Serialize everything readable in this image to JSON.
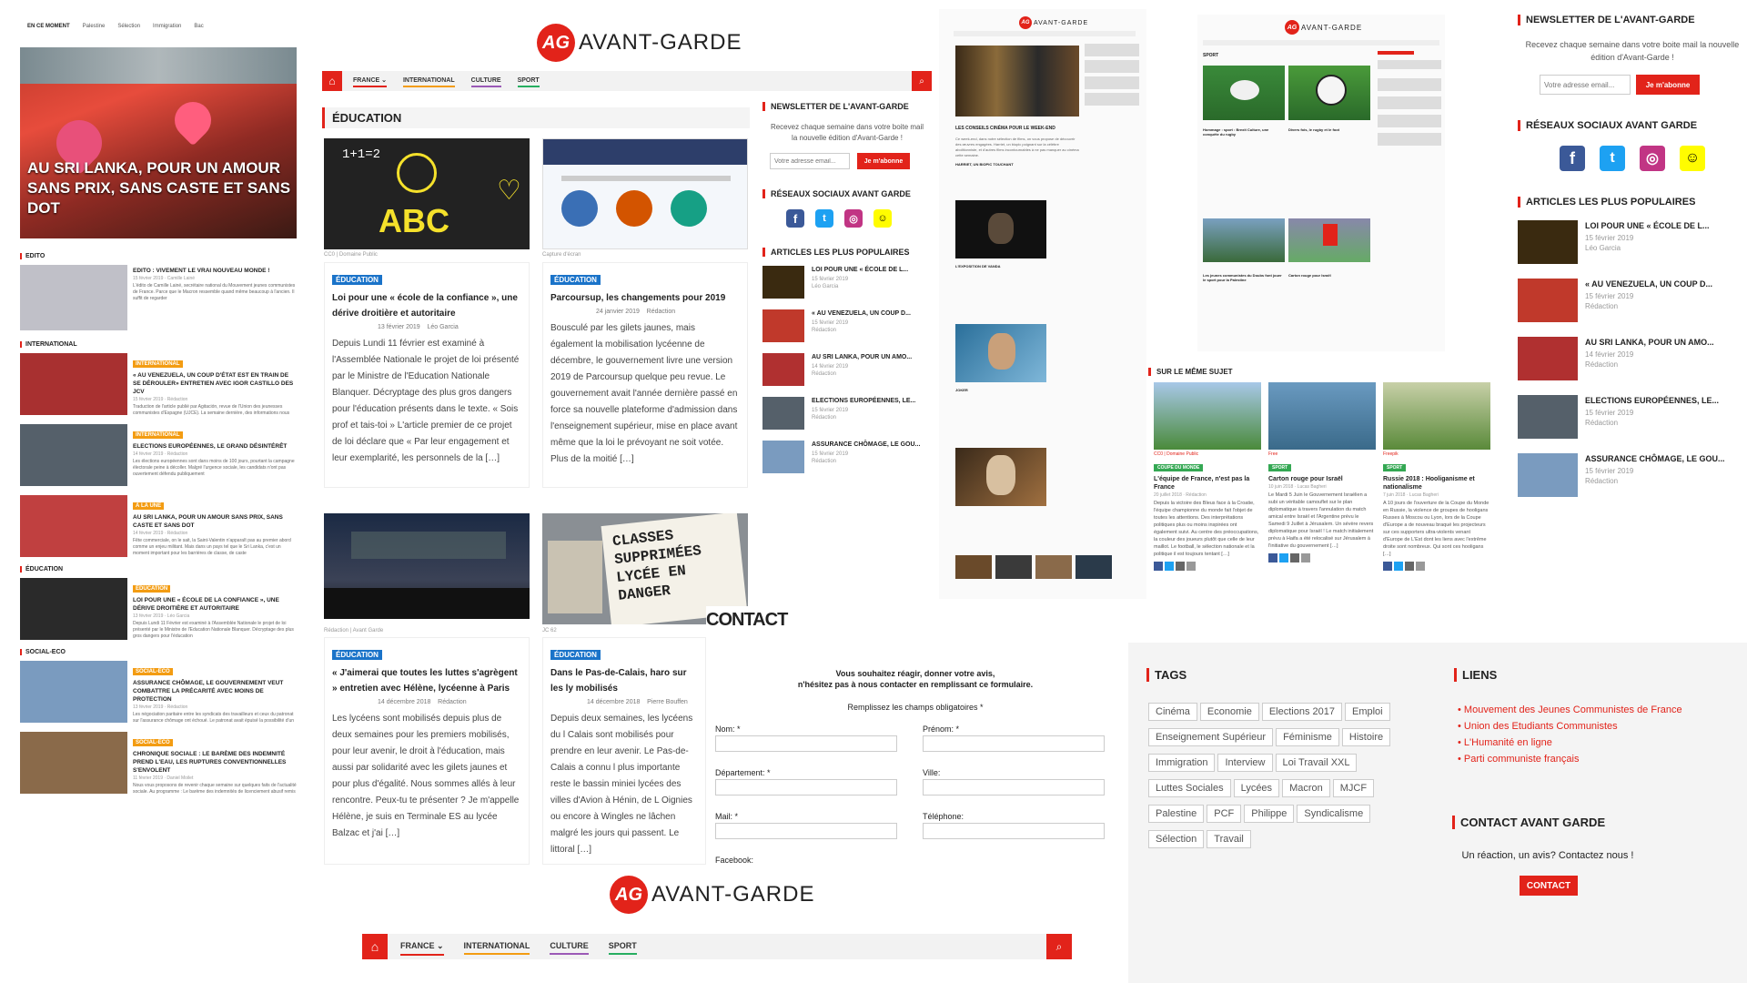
{
  "logo": {
    "initials": "AG",
    "name": "AVANT-GARDE"
  },
  "nav": {
    "items": [
      "FRANCE",
      "INTERNATIONAL",
      "CULTURE",
      "SPORT"
    ],
    "colors": [
      "#e2231a",
      "#f39c12",
      "#9b59b6",
      "#27ae60"
    ]
  },
  "mobile": {
    "breadcrumb": [
      "EN CE MOMENT",
      "Palestine",
      "Sélection",
      "Immigration",
      "Bac"
    ],
    "hero_title": "AU SRI LANKA, POUR UN AMOUR SANS PRIX, SANS CASTE ET SANS DOT",
    "sections": [
      {
        "head": "EDITO",
        "items": [
          {
            "cat": "",
            "title": "EDITO : VIVEMENT LE VRAI NOUVEAU MONDE !",
            "meta": "15 février 2019 · Camille Lainé",
            "excerpt": "L'édito de Camille Lainé, secrétaire national du Mouvement jeunes communistes de France. Parce que le Macron ressemble quand même beaucoup à l'ancien. Il suffit de regarder"
          }
        ]
      },
      {
        "head": "INTERNATIONAL",
        "items": [
          {
            "cat": "INTERNATIONAL",
            "title": "« AU VENEZUELA, UN COUP D'ÉTAT EST EN TRAIN DE SE DÉROULER» ENTRETIEN AVEC IGOR CASTILLO DES JCV",
            "meta": "15 février 2019 · Rédaction",
            "excerpt": "Traduction de l'article publié par Agitación, revue de l'Union des jeunesses communistes d'Espagne (UJCE). La semaine dernière, des informations nous sont arrivées à propos de travaux"
          },
          {
            "cat": "INTERNATIONAL",
            "title": "ELECTIONS EUROPÉENNES, LE GRAND DÉSINTÉRÊT",
            "meta": "14 février 2019 · Rédaction",
            "excerpt": "Les élections européennes sont dans moins de 100 jours, pourtant la campagne électorale peine à décoller. Malgré l'urgence sociale, les candidats n'ont pas ouvertement défendu publiquement"
          },
          {
            "cat": "À LA UNE",
            "title": "AU SRI LANKA, POUR UN AMOUR SANS PRIX, SANS CASTE ET SANS DOT",
            "meta": "14 février 2019 · Rédaction",
            "excerpt": "Fête commerciale, on le sait, la Saint-Valentin n'apparaît pas au premier abord comme un enjeu militant. Mais dans un pays tel que le Sri Lanka, c'est un moment important pour les barrières de classe, de caste"
          }
        ]
      },
      {
        "head": "ÉDUCATION",
        "items": [
          {
            "cat": "ÉDUCATION",
            "title": "LOI POUR UNE « ÉCOLE DE LA CONFIANCE », UNE DÉRIVE DROITIÈRE ET AUTORITAIRE",
            "meta": "13 février 2019 · Léo Garcia",
            "excerpt": "Depuis Lundi 11 Février est examiné à l'Assemblée Nationale le projet de loi présenté par le Ministre de l'Education Nationale Blanquer. Décryptage des plus gros dangers pour l'éducation"
          }
        ]
      },
      {
        "head": "SOCIAL-ECO",
        "items": [
          {
            "cat": "SOCIAL-ECO",
            "title": "ASSURANCE CHÔMAGE, LE GOUVERNEMENT VEUT COMBATTRE LA PRÉCARITÉ AVEC MOINS DE PROTECTION",
            "meta": "13 février 2019 · Rédaction",
            "excerpt": "Les négociation paritaire entre les syndicats des travailleurs et ceux du patronat sur l'assurance chômage ont échoué. Le patronat avait épuisé la possibilité d'un protestation de"
          },
          {
            "cat": "SOCIAL-ECO",
            "title": "CHRONIQUE SOCIALE : LE BARÈME DES INDEMNITÉ PREND L'EAU, LES RUPTURES CONVENTIONNELLES S'ENVOLENT",
            "meta": "11 février 2019 · Daniel Moilet",
            "excerpt": "Nous vous proposons de revenir chaque semaine sur quelques faits de l'actualité sociale. Au programme : Le barème des indemnités de licenciement abusif remis en question, évolutions des ruptures"
          }
        ]
      }
    ]
  },
  "education": {
    "title": "ÉDUCATION",
    "cards": [
      {
        "credit": "CC0 | Domaine Public",
        "cat": "ÉDUCATION",
        "title": "Loi pour une « école de la confiance », une dérive droitière et autoritaire",
        "date": "13 février 2019",
        "author": "Léo Garcia",
        "excerpt": "Depuis Lundi 11 février est examiné à l'Assemblée Nationale le projet de loi présenté par le Ministre de l'Education Nationale Blanquer. Décryptage des plus gros dangers pour l'éducation présents dans le texte. « Sois prof et tais-toi » L'article premier de ce projet de loi déclare que « Par leur engagement et leur exemplarité, les personnels de la […]"
      },
      {
        "credit": "Capture d'écran",
        "cat": "ÉDUCATION",
        "title": "Parcoursup, les changements pour 2019",
        "date": "24 janvier 2019",
        "author": "Rédaction",
        "excerpt": "Bousculé par les gilets jaunes, mais également la mobilisation lycéenne de décembre, le gouvernement livre une version 2019 de Parcoursup quelque peu revue. Le gouvernement avait l'année dernière passé en force sa nouvelle plateforme d'admission dans l'enseignement supérieur, mise en place avant même que la loi le prévoyant ne soit votée. Plus de la moitié […]"
      },
      {
        "credit": "Rédaction | Avant Garde",
        "cat": "ÉDUCATION",
        "title": "« J'aimerai que toutes les luttes s'agrègent » entretien avec Hélène, lycéenne à Paris",
        "date": "14 décembre 2018",
        "author": "Rédaction",
        "excerpt": "Les lycéens sont mobilisés depuis plus de deux semaines pour les premiers mobilisés, pour leur avenir, le droit à l'éducation, mais aussi par solidarité avec les gilets jaunes et pour plus d'égalité. Nous sommes allés à leur rencontre. Peux-tu te présenter ? Je m'appelle Hélène, je suis en Terminale ES au lycée Balzac et j'ai […]"
      },
      {
        "credit": "JC 62",
        "cat": "ÉDUCATION",
        "title": "Dans le Pas-de-Calais, haro sur les ly mobilisés",
        "date": "14 décembre 2018",
        "author": "Pierre Bouffen",
        "excerpt": "Depuis deux semaines, les lycéens du l Calais sont mobilisés pour prendre en leur avenir. Le Pas-de-Calais a connu l plus importante reste le bassin miniei lycées des villes d'Avion à Hénin, de L Oignies ou encore à Wingles ne lâchen malgré les jours qui passent. Le littoral […]"
      }
    ],
    "sign_text": "CLASSES SUPPRIMÉES LYCÉE EN DANGER",
    "chalk_text": "ABC"
  },
  "sidebar": {
    "newsletter_title": "NEWSLETTER DE L'AVANT-GARDE",
    "newsletter_text": "Recevez chaque semaine dans votre boite mail la nouvelle édition d'Avant-Garde !",
    "email_placeholder": "Votre adresse email...",
    "subscribe": "Je m'abonne",
    "social_title": "RÉSEAUX SOCIAUX AVANT GARDE",
    "popular_title": "ARTICLES LES PLUS POPULAIRES",
    "popular": [
      {
        "title": "LOI POUR UNE « ÉCOLE DE L...",
        "date": "15 février 2019",
        "author": "Léo Garcia"
      },
      {
        "title": "« AU VENEZUELA, UN COUP D...",
        "date": "15 février 2019",
        "author": "Rédaction"
      },
      {
        "title": "AU SRI LANKA, POUR UN AMO...",
        "date": "14 février 2019",
        "author": "Rédaction"
      },
      {
        "title": "ELECTIONS EUROPÉENNES, LE...",
        "date": "15 février 2019",
        "author": "Rédaction"
      },
      {
        "title": "ASSURANCE CHÔMAGE, LE GOU...",
        "date": "15 février 2019",
        "author": "Rédaction"
      }
    ],
    "popular_colors": [
      "#3a2a10",
      "#c0392b",
      "#b03030",
      "#55606a",
      "#7a9bbf"
    ]
  },
  "right_sidebar": {
    "newsletter_title": "NEWSLETTER DE L'AVANT-GARDE",
    "newsletter_text": "Recevez chaque semaine dans votre boite mail la nouvelle édition d'Avant-Garde !",
    "email_placeholder": "Votre adresse email...",
    "subscribe": "Je m'abonne",
    "social_title": "RÉSEAUX SOCIAUX AVANT GARDE",
    "popular_title": "ARTICLES LES PLUS POPULAIRES",
    "popular": [
      {
        "title": "LOI POUR UNE « ÉCOLE DE L...",
        "date": "15 février 2019",
        "author": "Léo Garcia"
      },
      {
        "title": "« AU VENEZUELA, UN COUP D...",
        "date": "15 février 2019",
        "author": "Rédaction"
      },
      {
        "title": "AU SRI LANKA, POUR UN AMO...",
        "date": "14 février 2019",
        "author": "Rédaction"
      },
      {
        "title": "ELECTIONS EUROPÉENNES, LE...",
        "date": "15 février 2019",
        "author": "Rédaction"
      },
      {
        "title": "ASSURANCE CHÔMAGE, LE GOU...",
        "date": "15 février 2019",
        "author": "Rédaction"
      }
    ]
  },
  "culture": {
    "title": "LES CONSEILS CINÉMA POUR LE WEEK-END",
    "body": "Ce week-end, dans notre sélection de films, on vous propose de découvrir des œuvres engagées. Harriet, un biopic poignant sur la célèbre abolitionniste, et d'autres films incontournables à ne pas manquer au cinéma cette semaine.",
    "sub1": "HARRIET, UN BIOPIC TOUCHANT",
    "sub2": "L'EXPOSITION DE VANDA",
    "sub3": "JOKER"
  },
  "sport": {
    "section": "SPORT",
    "a1": "Hommage : sport : Brexit Culture, une conquête du rugby",
    "a2": "Divers fois, le rugby et le foot",
    "a3": "Les jeunes communistes du Doubs font jouer le sport pour la Palestine",
    "a4": "Carton rouge pour Israël"
  },
  "same_topic": {
    "title": "SUR LE MÊME SUJET",
    "items": [
      {
        "credit": "CC0 | Domaine Public",
        "cat": "COUPE DU MONDE",
        "title": "L'équipe de France, n'est pas la France",
        "meta": "20 juillet 2018 · Rédaction",
        "excerpt": "Depuis la victoire des Bleus face à la Croatie, l'équipe championne du monde fait l'objet de toutes les attentions. Des interprétations politiques plus ou moins inspirées ont également suivi. Au centre des préoccupations, la couleur des joueurs plutôt que celle de leur maillot. Le football, le sélection nationale et la politique il est toujours tentant […]"
      },
      {
        "credit": "Free",
        "cat": "SPORT",
        "title": "Carton rouge pour Israël",
        "meta": "10 juin 2018 · Lucas Bagheri",
        "excerpt": "Le Mardi 5 Juin le Gouvernement Israélien a subi un véritable camouflet sur le plan diplomatique à travers l'annulation du match amical entre Israël et l'Argentine prévu le Samedi 9 Juillet à Jérusalem. Un sévère revers diplomatique pour Israël ! Le match initialement prévu à Haifa a été relocalisé sur Jérusalem à l'initiative du gouvernement […]"
      },
      {
        "credit": "Freepik",
        "cat": "SPORT",
        "title": "Russie 2018 : Hooliganisme et nationalisme",
        "meta": "7 juin 2018 · Lucas Bagheri",
        "excerpt": "A 10 jours de l'ouverture de la Coupe du Monde en Russie, la violence de groupes de hooligans Russes à Moscou ou Lyon, lors de la Coupe d'Europe a de nouveau braqué les projecteurs sur ces supporters ultra-violents venant d'Europe de L'Est dont les liens avec l'extrême droite sont nombreux. Qui sont ces hooligans […]"
      }
    ]
  },
  "contact": {
    "title": "CONTACT",
    "intro1": "Vous souhaitez réagir, donner votre avis,",
    "intro2": "n'hésitez pas à nous contacter en remplissant ce formulaire.",
    "required": "Remplissez les champs obligatoires *",
    "fields": {
      "nom": "Nom: *",
      "prenom": "Prénom: *",
      "departement": "Département: *",
      "ville": "Ville:",
      "mail": "Mail: *",
      "telephone": "Téléphone:",
      "facebook": "Facebook:"
    }
  },
  "footer": {
    "tags_title": "TAGS",
    "tags": [
      "Cinéma",
      "Economie",
      "Elections 2017",
      "Emploi",
      "Enseignement Supérieur",
      "Féminisme",
      "Histoire",
      "Immigration",
      "Interview",
      "Loi Travail XXL",
      "Luttes Sociales",
      "Lycées",
      "Macron",
      "MJCF",
      "Palestine",
      "PCF",
      "Philippe",
      "Syndicalisme",
      "Sélection",
      "Travail"
    ],
    "links_title": "LIENS",
    "links": [
      "Mouvement des Jeunes Communistes de France",
      "Union des Etudiants Communistes",
      "L'Humanité en ligne",
      "Parti communiste français"
    ],
    "contact_title": "CONTACT AVANT GARDE",
    "contact_text": "Un réaction, un avis? Contactez nous !",
    "contact_button": "CONTACT"
  },
  "social_icons": [
    {
      "name": "facebook-icon",
      "glyph": "f",
      "color": "#3b5998"
    },
    {
      "name": "twitter-icon",
      "glyph": "t",
      "color": "#1da1f2"
    },
    {
      "name": "instagram-icon",
      "glyph": "◎",
      "color": "#c13584"
    },
    {
      "name": "snapchat-icon",
      "glyph": "👻",
      "color": "#fffc00"
    }
  ]
}
